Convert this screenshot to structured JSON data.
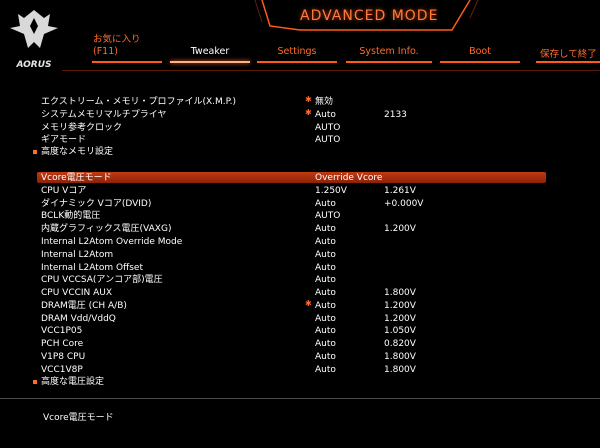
{
  "header": {
    "brand": "AORUS",
    "mode_title": "ADVANCED MODE",
    "favorites_label": "お気に入り",
    "favorites_key": "(F11)",
    "tabs": [
      {
        "label": "Tweaker",
        "active": true
      },
      {
        "label": "Settings",
        "active": false
      },
      {
        "label": "System Info.",
        "active": false
      },
      {
        "label": "Boot",
        "active": false
      }
    ],
    "save_exit": "保存して終了"
  },
  "colors": {
    "accent": "#ff6d2b",
    "highlight": "#c23a12",
    "background": "#000000"
  },
  "memory": {
    "rows": [
      {
        "label": "エクストリーム・メモリ・プロファイル(X.M.P.)",
        "star": true,
        "v1": "無効",
        "v2": ""
      },
      {
        "label": "システムメモリマルチプライヤ",
        "star": true,
        "v1": "Auto",
        "v2": "2133"
      },
      {
        "label": "メモリ参考クロック",
        "star": false,
        "v1": "AUTO",
        "v2": ""
      },
      {
        "label": "ギアモード",
        "star": false,
        "v1": "AUTO",
        "v2": ""
      }
    ],
    "advanced": "高度なメモリ設定"
  },
  "voltage": {
    "selected": {
      "label": "Vcore電圧モード",
      "v1": "Override Vcore"
    },
    "rows": [
      {
        "label": "CPU Vコア",
        "star": false,
        "v1": "1.250V",
        "v2": "1.261V"
      },
      {
        "label": "ダイナミック Vコア(DVID)",
        "star": false,
        "v1": "Auto",
        "v2": "+0.000V"
      },
      {
        "label": "BCLK動的電圧",
        "star": false,
        "v1": "AUTO",
        "v2": ""
      },
      {
        "label": "内蔵グラフィックス電圧(VAXG)",
        "star": false,
        "v1": "Auto",
        "v2": "1.200V"
      },
      {
        "label": "Internal L2Atom Override Mode",
        "star": false,
        "v1": "Auto",
        "v2": ""
      },
      {
        "label": "Internal L2Atom",
        "star": false,
        "v1": "Auto",
        "v2": ""
      },
      {
        "label": "Internal L2Atom Offset",
        "star": false,
        "v1": "Auto",
        "v2": ""
      },
      {
        "label": "CPU VCCSA(アンコア部)電圧",
        "star": false,
        "v1": "Auto",
        "v2": ""
      },
      {
        "label": "CPU VCCIN AUX",
        "star": false,
        "v1": "Auto",
        "v2": "1.800V"
      },
      {
        "label": "DRAM電圧 (CH A/B)",
        "star": true,
        "v1": "Auto",
        "v2": "1.200V"
      },
      {
        "label": "DRAM Vdd/VddQ",
        "star": false,
        "v1": "Auto",
        "v2": "1.200V"
      },
      {
        "label": "VCC1P05",
        "star": false,
        "v1": "Auto",
        "v2": "1.050V"
      },
      {
        "label": "PCH Core",
        "star": false,
        "v1": "Auto",
        "v2": "0.820V"
      },
      {
        "label": "V1P8 CPU",
        "star": false,
        "v1": "Auto",
        "v2": "1.800V"
      },
      {
        "label": "VCC1V8P",
        "star": false,
        "v1": "Auto",
        "v2": "1.800V"
      }
    ],
    "advanced": "高度な電圧設定"
  },
  "help_text": "Vcore電圧モード"
}
